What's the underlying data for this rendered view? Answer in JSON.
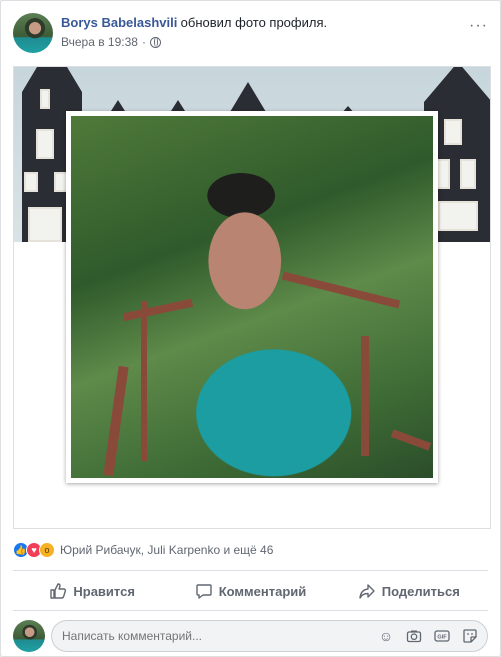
{
  "post": {
    "author": "Borys Babelashvili",
    "action": "обновил фото профиля.",
    "time": "Вчера в 19:38",
    "separator": "·",
    "more": "···"
  },
  "reactions": {
    "names": "Юрий Рибачук, Juli Karpenko и ещё 46",
    "types": [
      "like-icon",
      "love-icon",
      "wow-icon"
    ]
  },
  "actions": {
    "like": "Нравится",
    "comment": "Комментарий",
    "share": "Поделиться"
  },
  "comment": {
    "placeholder": "Написать комментарий..."
  },
  "colors": {
    "accent": "#385898",
    "like": "#1877f2",
    "love": "#f33e58",
    "wow": "#f7b125"
  }
}
